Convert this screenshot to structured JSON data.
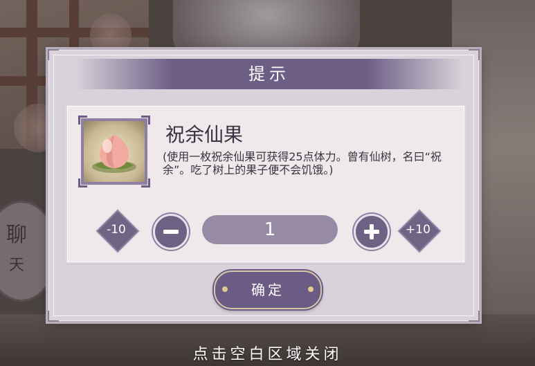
{
  "background": {
    "chat_button_label": [
      "聊",
      "天"
    ]
  },
  "dialog": {
    "title": "提示",
    "item": {
      "icon": "peach-icon",
      "name": "祝余仙果",
      "description": "(使用一枚祝余仙果可获得25点体力。曾有仙树，名曰“祝余”。吃了树上的果子便不会饥饿。)"
    },
    "quantity": {
      "minus_ten_label": "-10",
      "minus_icon": "minus-icon",
      "value": "1",
      "plus_icon": "plus-icon",
      "plus_ten_label": "+10"
    },
    "confirm_label": "确定"
  },
  "close_hint": "点击空白区域关闭",
  "colors": {
    "accent": "#6d5e86",
    "dialog_bg": "#d9d2da",
    "card_bg": "#efe9ec",
    "gold": "#e3c98d"
  }
}
